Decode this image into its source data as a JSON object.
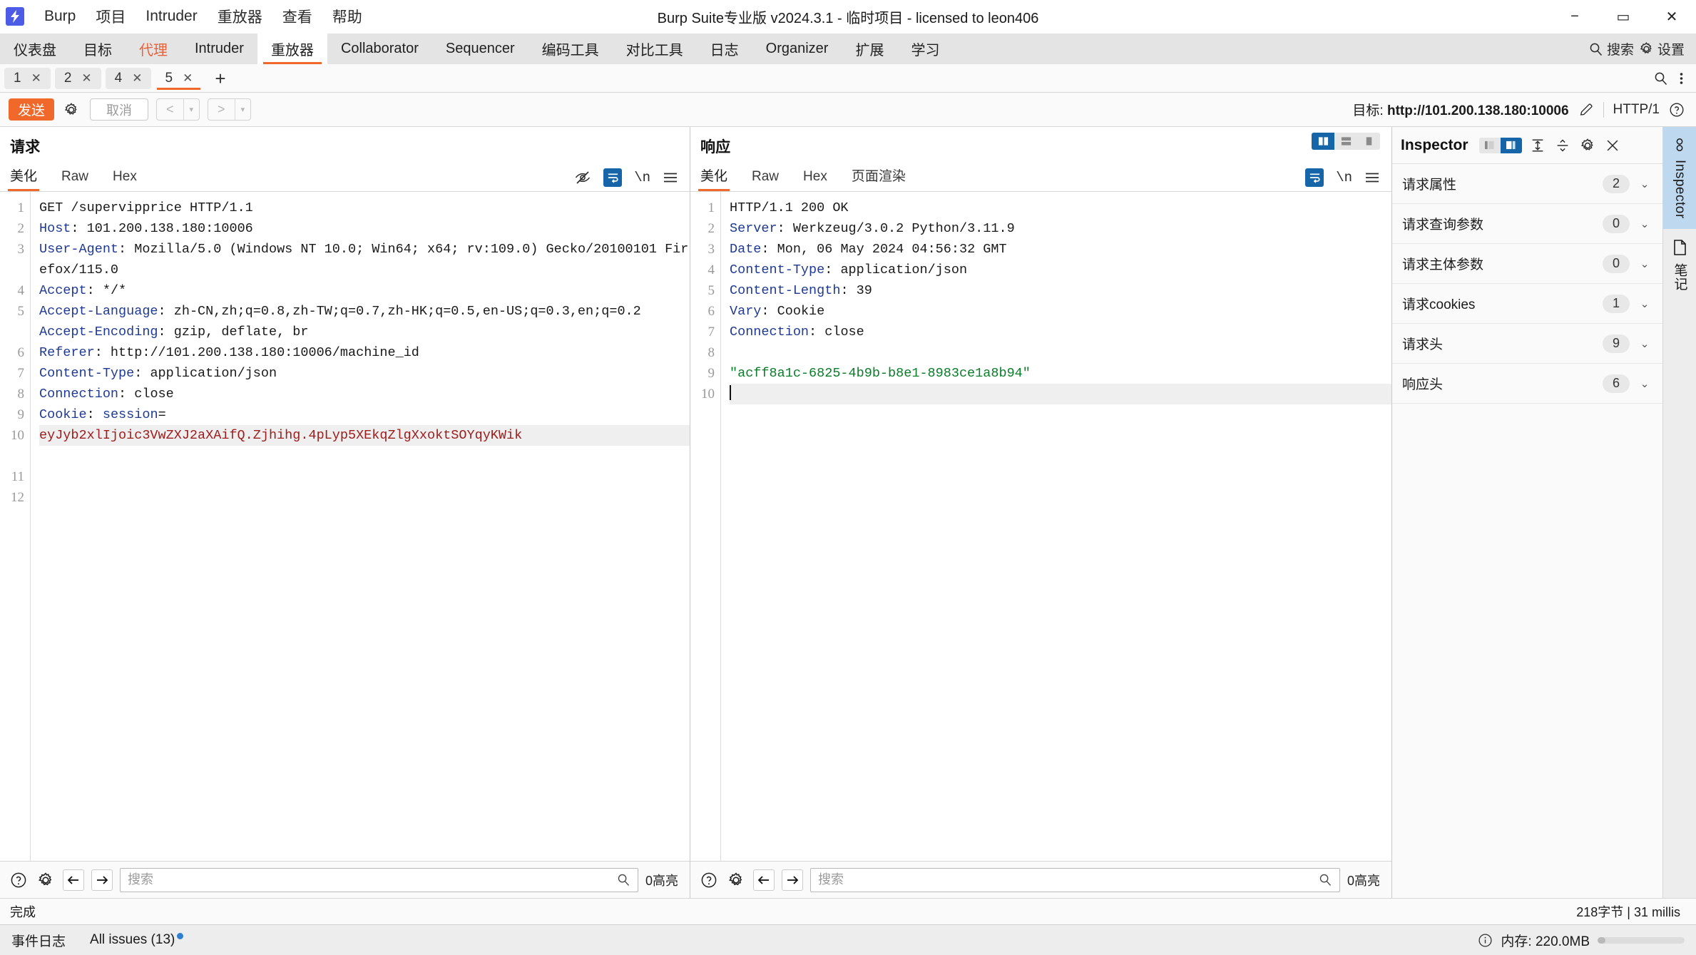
{
  "window": {
    "title": "Burp Suite专业版  v2024.3.1 - 临时项目 - licensed to leon406",
    "logo_glyph": "⚡",
    "minimize": "−",
    "maximize": "▭",
    "close": "✕"
  },
  "menubar": {
    "items": [
      {
        "label": "Burp"
      },
      {
        "label": "项目"
      },
      {
        "label": "Intruder"
      },
      {
        "label": "重放器"
      },
      {
        "label": "查看"
      },
      {
        "label": "帮助"
      }
    ]
  },
  "mainnav": {
    "tabs": [
      {
        "label": "仪表盘",
        "state": "normal"
      },
      {
        "label": "目标",
        "state": "normal"
      },
      {
        "label": "代理",
        "state": "accent"
      },
      {
        "label": "Intruder",
        "state": "normal"
      },
      {
        "label": "重放器",
        "state": "active"
      },
      {
        "label": "Collaborator",
        "state": "normal"
      },
      {
        "label": "Sequencer",
        "state": "normal"
      },
      {
        "label": "编码工具",
        "state": "normal"
      },
      {
        "label": "对比工具",
        "state": "normal"
      },
      {
        "label": "日志",
        "state": "normal"
      },
      {
        "label": "Organizer",
        "state": "normal"
      },
      {
        "label": "扩展",
        "state": "normal"
      },
      {
        "label": "学习",
        "state": "normal"
      }
    ],
    "search_label": "搜索",
    "settings_label": "设置"
  },
  "repeater": {
    "tabs": [
      {
        "label": "1",
        "close": "✕",
        "active": false
      },
      {
        "label": "2",
        "close": "✕",
        "active": false
      },
      {
        "label": "4",
        "close": "✕",
        "active": false
      },
      {
        "label": "5",
        "close": "✕",
        "active": true
      }
    ],
    "add_label": "+"
  },
  "toolbar": {
    "send_label": "发送",
    "cancel_label": "取消",
    "back_label": "<",
    "forward_label": ">",
    "caret": "▾",
    "target_prefix": "目标: ",
    "target_url": "http://101.200.138.180:10006",
    "http_version": "HTTP/1"
  },
  "request": {
    "title": "请求",
    "tabs": [
      {
        "label": "美化",
        "active": true
      },
      {
        "label": "Raw",
        "active": false
      },
      {
        "label": "Hex",
        "active": false
      }
    ],
    "lines": [
      {
        "n": "1",
        "method": "GET",
        "path": "/supervipprice",
        "proto": " HTTP/1.1"
      },
      {
        "n": "2",
        "header": "Host",
        "value": " 101.200.138.180:10006"
      },
      {
        "n": "3",
        "header": "User-Agent",
        "value": " Mozilla/5.0 (Windows NT 10.0; Win64; x64; rv:109.0) Gecko/20100101 Firefox/115.0"
      },
      {
        "n": "4",
        "header": "Accept",
        "value": " */*"
      },
      {
        "n": "5",
        "header": "Accept-Language",
        "value": " zh-CN,zh;q=0.8,zh-TW;q=0.7,zh-HK;q=0.5,en-US;q=0.3,en;q=0.2"
      },
      {
        "n": "6",
        "header": "Accept-Encoding",
        "value": " gzip, deflate, br"
      },
      {
        "n": "7",
        "header": "Referer",
        "value": " http://101.200.138.180:10006/machine_id"
      },
      {
        "n": "8",
        "header": "Content-Type",
        "value": " application/json"
      },
      {
        "n": "9",
        "header": "Connection",
        "value": " close"
      }
    ],
    "cookie_line_no": "10",
    "cookie_header": "Cookie",
    "cookie_name": " session",
    "cookie_eq": "=",
    "cookie_value": "eyJyb2xlIjoic3VwZXJ2aXAifQ.Zjhihg.4pLyp5XEkqZlgXxoktSOYqyKWik",
    "trailing_line_nums": [
      "11",
      "12"
    ],
    "footer": {
      "help": "?",
      "search_placeholder": "搜索",
      "highlight_count": "0高亮"
    }
  },
  "response": {
    "title": "响应",
    "tabs": [
      {
        "label": "美化",
        "active": true
      },
      {
        "label": "Raw",
        "active": false
      },
      {
        "label": "Hex",
        "active": false
      },
      {
        "label": "页面渲染",
        "active": false
      }
    ],
    "lines": [
      {
        "n": "1",
        "plain": "HTTP/1.1 200 OK"
      },
      {
        "n": "2",
        "header": "Server",
        "value": " Werkzeug/3.0.2 Python/3.11.9"
      },
      {
        "n": "3",
        "header": "Date",
        "value": " Mon, 06 May 2024 04:56:32 GMT"
      },
      {
        "n": "4",
        "header": "Content-Type",
        "value": " application/json"
      },
      {
        "n": "5",
        "header": "Content-Length",
        "value": " 39"
      },
      {
        "n": "6",
        "header": "Vary",
        "value": " Cookie"
      },
      {
        "n": "7",
        "header": "Connection",
        "value": " close"
      },
      {
        "n": "8",
        "plain": ""
      }
    ],
    "body_line_no": "9",
    "body_value": "\"acff8a1c-6825-4b9b-b8e1-8983ce1a8b94\"",
    "caret_line_no": "10",
    "footer": {
      "help": "?",
      "search_placeholder": "搜索",
      "highlight_count": "0高亮"
    }
  },
  "inspector": {
    "title": "Inspector",
    "rows": [
      {
        "label": "请求属性",
        "count": "2"
      },
      {
        "label": "请求查询参数",
        "count": "0"
      },
      {
        "label": "请求主体参数",
        "count": "0"
      },
      {
        "label": "请求cookies",
        "count": "1"
      },
      {
        "label": "请求头",
        "count": "9"
      },
      {
        "label": "响应头",
        "count": "6"
      }
    ],
    "chevron": "⌄",
    "close": "✕"
  },
  "rail": {
    "tabs": [
      {
        "label": "Inspector",
        "active": true
      },
      {
        "label": "笔记",
        "active": false
      }
    ]
  },
  "status": {
    "left": "完成",
    "right": "218字节 | 31 millis"
  },
  "bottom": {
    "event_log": "事件日志",
    "issues": "All issues (13)",
    "memory": "内存: 220.0MB",
    "info_glyph": "i"
  },
  "colors": {
    "accent": "#f0682a",
    "blue": "#1565a8",
    "header_blue": "#1f3a93",
    "cookie_red": "#9c1b1b",
    "json_green": "#0a7d29"
  }
}
